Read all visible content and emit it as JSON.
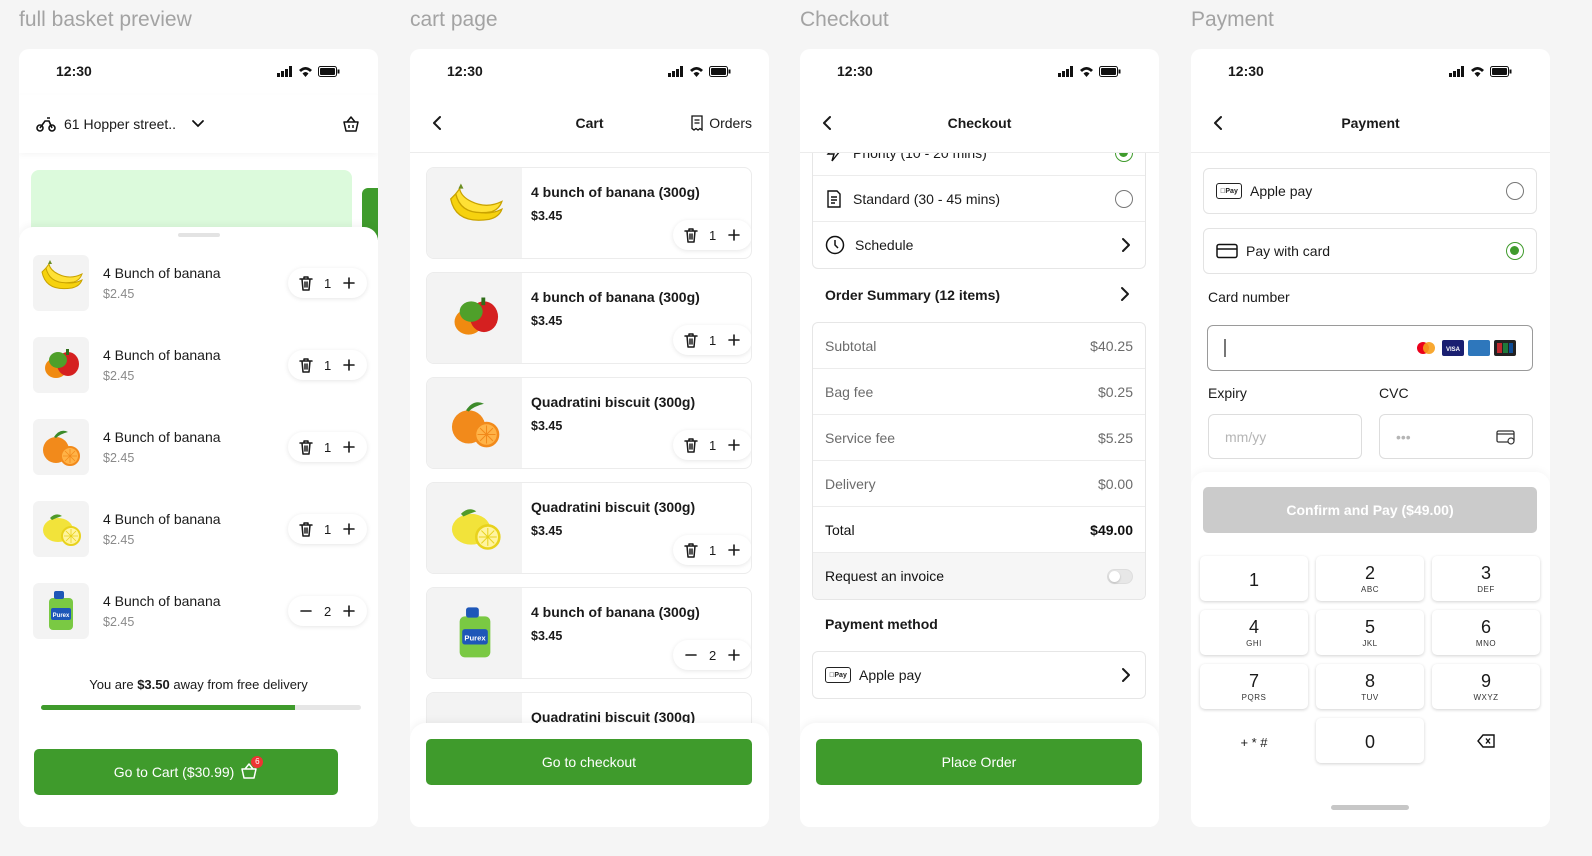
{
  "stages": {
    "basket": "full basket preview",
    "cart": "cart page",
    "checkout": "Checkout",
    "payment": "Payment"
  },
  "status_time": "12:30",
  "basket": {
    "address": "61 Hopper street..",
    "items": [
      {
        "name": "4 Bunch of banana",
        "price": "$2.45",
        "qty": "1",
        "img": "banana-image",
        "left_action": "trash-icon"
      },
      {
        "name": "4 Bunch of banana",
        "price": "$2.45",
        "qty": "1",
        "img": "pepper-image",
        "left_action": "trash-icon"
      },
      {
        "name": "4 Bunch of banana",
        "price": "$2.45",
        "qty": "1",
        "img": "orange-image",
        "left_action": "trash-icon"
      },
      {
        "name": "4 Bunch of banana",
        "price": "$2.45",
        "qty": "1",
        "img": "lemon-image",
        "left_action": "trash-icon"
      },
      {
        "name": "4 Bunch of banana",
        "price": "$2.45",
        "qty": "2",
        "img": "detergent-image",
        "left_action": "minus-icon"
      }
    ],
    "delivery_prefix": "You are",
    "delivery_amount": "$3.50",
    "delivery_suffix": "away from free delivery",
    "delivery_progress": 0.795,
    "cta": "Go to Cart ($30.99)",
    "cart_badge": "6"
  },
  "cart": {
    "title": "Cart",
    "orders": "Orders",
    "items": [
      {
        "name": "4 bunch of banana (300g)",
        "price": "$3.45",
        "qty": "1",
        "img": "banana-image",
        "left_action": "trash-icon"
      },
      {
        "name": "4 bunch of banana (300g)",
        "price": "$3.45",
        "qty": "1",
        "img": "pepper-image",
        "left_action": "trash-icon"
      },
      {
        "name": "Quadratini biscuit (300g)",
        "price": "$3.45",
        "qty": "1",
        "img": "orange-image",
        "left_action": "trash-icon"
      },
      {
        "name": "Quadratini biscuit (300g)",
        "price": "$3.45",
        "qty": "1",
        "img": "lemon-image",
        "left_action": "trash-icon"
      },
      {
        "name": "4 bunch of banana (300g)",
        "price": "$3.45",
        "qty": "2",
        "img": "detergent-image",
        "left_action": "minus-icon"
      },
      {
        "name": "Quadratini biscuit (300g)",
        "price": "",
        "qty": "",
        "img": "biscuit-image",
        "left_action": ""
      }
    ],
    "cta": "Go to checkout"
  },
  "checkout": {
    "title": "Checkout",
    "priority": "Priority (10 - 20 mins)",
    "standard": "Standard (30 - 45 mins)",
    "schedule": "Schedule",
    "order_summary": "Order Summary (12 items)",
    "subtotal_label": "Subtotal",
    "subtotal": "$40.25",
    "bag_fee_label": "Bag fee",
    "bag_fee": "$0.25",
    "service_fee_label": "Service fee",
    "service_fee": "$5.25",
    "delivery_label": "Delivery",
    "delivery": "$0.00",
    "total_label": "Total",
    "total": "$49.00",
    "invoice_label": "Request an invoice",
    "payment_method_label": "Payment method",
    "payment_method": "Apple pay",
    "pay_tag": "Pay",
    "cta": "Place Order"
  },
  "payment": {
    "title": "Payment",
    "apple_pay": "Apple pay",
    "pay_tag": "Pay",
    "card": "Pay with card",
    "card_number_label": "Card number",
    "expiry_label": "Expiry",
    "expiry_placeholder": "mm/yy",
    "cvc_label": "CVC",
    "cvc_placeholder": "•••",
    "cta": "Confirm and Pay ($49.00)",
    "keys": [
      {
        "n": "1",
        "s": ""
      },
      {
        "n": "2",
        "s": "ABC"
      },
      {
        "n": "3",
        "s": "DEF"
      },
      {
        "n": "4",
        "s": "GHI"
      },
      {
        "n": "5",
        "s": "JKL"
      },
      {
        "n": "6",
        "s": "MNO"
      },
      {
        "n": "7",
        "s": "PQRS"
      },
      {
        "n": "8",
        "s": "TUV"
      },
      {
        "n": "9",
        "s": "WXYZ"
      },
      {
        "n": "+ * #",
        "s": ""
      },
      {
        "n": "0",
        "s": ""
      },
      {
        "n": "",
        "s": ""
      }
    ]
  },
  "colors": {
    "brand": "#3f9b2c",
    "disabled": "#cbcbcb"
  }
}
